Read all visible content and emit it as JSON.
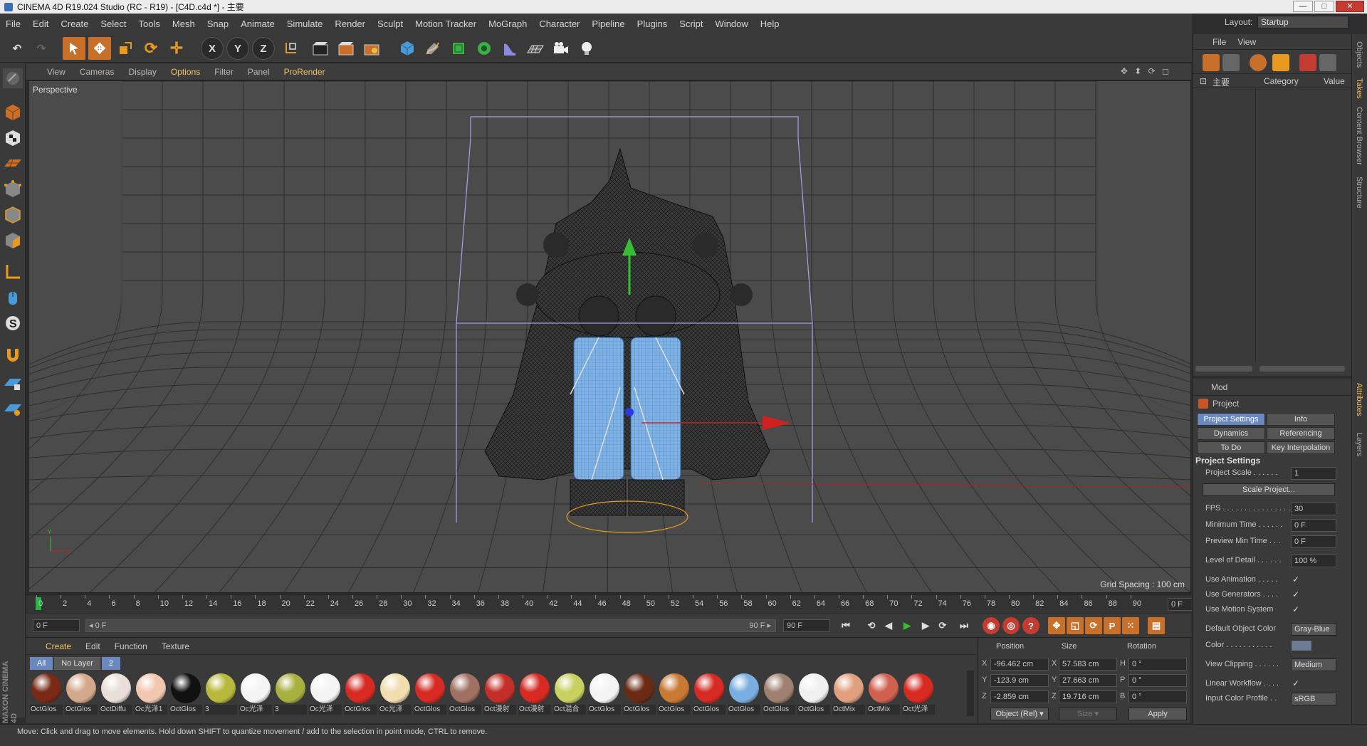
{
  "window": {
    "title": "CINEMA 4D R19.024 Studio (RC - R19) - [C4D.c4d *] - 主要",
    "minimize": "—",
    "maximize": "□",
    "close": "✕"
  },
  "menu": [
    "File",
    "Edit",
    "Create",
    "Select",
    "Tools",
    "Mesh",
    "Snap",
    "Animate",
    "Simulate",
    "Render",
    "Sculpt",
    "Motion Tracker",
    "MoGraph",
    "Character",
    "Pipeline",
    "Plugins",
    "Script",
    "Window",
    "Help"
  ],
  "layout": {
    "label": "Layout:",
    "value": "Startup"
  },
  "toolbar": {
    "x": "X",
    "y": "Y",
    "z": "Z"
  },
  "viewport": {
    "menu": [
      "View",
      "Cameras",
      "Display",
      "Options",
      "Filter",
      "Panel",
      "ProRender"
    ],
    "highlight": "Options",
    "camera": "Perspective",
    "grid_spacing": "Grid Spacing : 100 cm",
    "nav": "✥ ⬍ ⟳ ◻"
  },
  "timeline": {
    "labels": [
      "0",
      "2",
      "4",
      "6",
      "8",
      "10",
      "12",
      "14",
      "16",
      "18",
      "20",
      "22",
      "24",
      "26",
      "28",
      "30",
      "32",
      "34",
      "36",
      "38",
      "40",
      "42",
      "44",
      "46",
      "48",
      "50",
      "52",
      "54",
      "56",
      "58",
      "60",
      "62",
      "64",
      "66",
      "68",
      "70",
      "72",
      "74",
      "76",
      "78",
      "80",
      "82",
      "84",
      "86",
      "88",
      "90"
    ],
    "current_frame": "0 F"
  },
  "anim": {
    "start": "0 F",
    "slider_start": "◂ 0 F",
    "slider_end": "90 F ▸",
    "end": "90 F"
  },
  "materials": {
    "menu": [
      "Create",
      "Edit",
      "Function",
      "Texture"
    ],
    "tabs": [
      "All",
      "No Layer",
      "2"
    ],
    "items": [
      {
        "name": "OctGlos",
        "color": "#7a2a14"
      },
      {
        "name": "OctGlos",
        "color": "#d4a88a"
      },
      {
        "name": "OctDiffu",
        "color": "#e8e0d8"
      },
      {
        "name": "Oc光泽1",
        "color": "#f2c7b0"
      },
      {
        "name": "OctGlos",
        "color": "#111111"
      },
      {
        "name": "3",
        "color": "#b8b83c"
      },
      {
        "name": "Oc光泽",
        "color": "#f4f4f4"
      },
      {
        "name": "3",
        "color": "#a8b040"
      },
      {
        "name": "Oc光泽",
        "color": "#f4f4f4"
      },
      {
        "name": "OctGlos",
        "color": "#d62a22"
      },
      {
        "name": "Oc光泽",
        "color": "#f0ddb0"
      },
      {
        "name": "OctGlos",
        "color": "#d62a22"
      },
      {
        "name": "OctGlos",
        "color": "#a07060"
      },
      {
        "name": "Oct漫射",
        "color": "#c42e28"
      },
      {
        "name": "Oct漫射",
        "color": "#d62a22"
      },
      {
        "name": "Oct混合",
        "color": "#c8d060"
      },
      {
        "name": "OctGlos",
        "color": "#f4f4f4"
      },
      {
        "name": "OctGlos",
        "color": "#6a2a14"
      },
      {
        "name": "OctGlos",
        "color": "#c87a34"
      },
      {
        "name": "OctGlos",
        "color": "#d62a22"
      },
      {
        "name": "OctGlos",
        "color": "#7aaee0"
      },
      {
        "name": "OctGlos",
        "color": "#a08070"
      },
      {
        "name": "OctGlos",
        "color": "#f0f0f0"
      },
      {
        "name": "OctMix",
        "color": "#e0a080"
      },
      {
        "name": "OctMix",
        "color": "#d06050"
      },
      {
        "name": "Oct光泽",
        "color": "#d62a22"
      }
    ]
  },
  "coords": {
    "headers": {
      "position": "Position",
      "size": "Size",
      "rotation": "Rotation"
    },
    "x_pos": "-96.462 cm",
    "y_pos": "-123.9 cm",
    "z_pos": "-2.859 cm",
    "x_size": "57.583 cm",
    "y_size": "27.663 cm",
    "z_size": "19.716 cm",
    "h": "0 °",
    "p": "0 °",
    "b": "0 °",
    "axis_x": "X",
    "axis_y": "Y",
    "axis_z": "Z",
    "axis_h": "H",
    "axis_p": "P",
    "axis_b": "B",
    "mode": "Object (Rel) ▾",
    "size_mode": "Size ▾",
    "apply": "Apply"
  },
  "status": "Move: Click and drag to move elements. Hold down SHIFT to quantize movement / add to the selection in point mode, CTRL to remove.",
  "branding": "MAXON CINEMA 4D",
  "objects": {
    "menu": [
      "File",
      "View"
    ],
    "tree_root": "主要",
    "columns": {
      "category": "Category",
      "value": "Value"
    }
  },
  "attributes": {
    "menu": "Mod",
    "title": "Project",
    "tabs": [
      "Project Settings",
      "Info",
      "Dynamics",
      "Referencing",
      "To Do",
      "Key Interpolation"
    ],
    "section": "Project Settings",
    "rows": {
      "scale_label": "Project Scale . . . . . .",
      "scale_value": "1",
      "scale_btn": "Scale Project...",
      "fps_label": "FPS . . . . . . . . . . . . . . . .",
      "fps_value": "30",
      "min_time_label": "Minimum Time . . . . . .",
      "min_time_value": "0 F",
      "prev_min_label": "Preview Min Time . . .",
      "prev_min_value": "0 F",
      "lod_label": "Level of Detail . . . . . .",
      "lod_value": "100 %",
      "use_anim_label": "Use Animation . . . . .",
      "use_gen_label": "Use Generators . . . .",
      "use_motion_label": "Use Motion System",
      "def_color_label": "Default Object Color",
      "def_color_value": "Gray-Blue",
      "color_label": "Color . . . . . . . . . . .",
      "view_clip_label": "View Clipping . . . . . .",
      "view_clip_value": "Medium",
      "linear_label": "Linear Workflow . . . .",
      "icc_label": "Input Color Profile . .",
      "icc_value": "sRGB"
    },
    "check": "✓"
  },
  "side_tabs": [
    "Objects",
    "Takes",
    "Content Browser",
    "Structure",
    "Attributes",
    "Layers"
  ]
}
